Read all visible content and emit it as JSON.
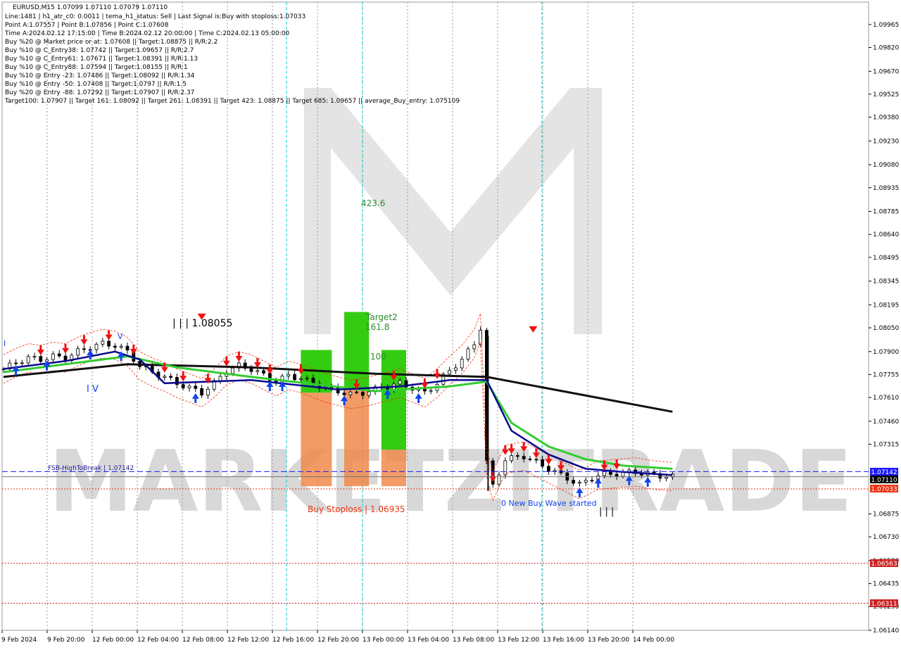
{
  "header": {
    "symbol_line": "EURUSD,M15  1.07099 1.07110 1.07079 1.07110",
    "info_lines": [
      "Line:1481 | h1_atr_c0: 0.0011 | tema_h1_status: Sell | Last Signal is:Buy with stoploss:1.07033",
      "Point A:1.07557 | Point B:1.07856 | Point C:1.07608",
      "Time A:2024.02.12 17:15:00 | Time B:2024.02.12 20:00:00 | Time C:2024.02.13 05:00:00",
      "Buy %20 @ Market price or at: 1.07608 || Target:1.08875 || R/R:2.2",
      "Buy %10 @ C_Entry38: 1.07742 || Target:1.09657 || R/R:2.7",
      "Buy %10 @ C_Entry61: 1.07671 || Target:1.08391 || R/R:1.13",
      "Buy %10 @ C_Entry88: 1.07594 || Target:1.08155 || R/R:1",
      "Buy %10 @ Entry -23: 1.07486 || Target:1.08092 || R/R:1.34",
      "Buy %10 @ Entry -50: 1.07408 || Target:1.0797 || R/R:1.5",
      "Buy %20 @ Entry -88: 1.07292 || Target:1.07907 || R/R:2.37",
      "Target100: 1.07907 || Target 161: 1.08092 || Target 261: 1.08391 || Target 423: 1.08875 || Target 685: 1.09657 || average_Buy_entry: 1.075109"
    ]
  },
  "annotations": {
    "high_label": "| | | 1.08055",
    "wave_label_iv": "I V",
    "fsb_label": "FSB-HighToBreak | 1.07142",
    "buy_stoploss": "Buy Stoploss | 1.06935",
    "new_wave": "0 New Buy Wave started",
    "target_423": "423.6",
    "target2_a": "Target2",
    "target2_b": "161.8",
    "target_100": "100",
    "wave_iii": "| | |",
    "wave_v": "V",
    "wave_i": "I"
  },
  "price_badges": {
    "fsb": "1.07142",
    "current": "1.07110",
    "stop": "1.07033",
    "level1": "1.06563",
    "level2": "1.06311"
  },
  "colors": {
    "background": "#ffffff",
    "ema_green": "#33cc33",
    "ema_navy": "#0a0a8c",
    "sma_black": "#111111",
    "red_arrow": "#ee1111",
    "blue_arrow": "#1144ee",
    "cyan_line": "#00cccc",
    "box_green": "#33cc11",
    "box_orange": "#f08a4b",
    "fsb_blue": "#1a1aff",
    "stop_red": "#ee3311",
    "level_red": "#cc2222",
    "watermark": "#d7d7d7"
  },
  "chart_data": {
    "type": "candlestick",
    "symbol": "EURUSD",
    "timeframe": "M15",
    "ylim": [
      1.0614,
      1.0996
    ],
    "y_ticks": [
      "1.09965",
      "1.09820",
      "1.09670",
      "1.09525",
      "1.09380",
      "1.09230",
      "1.09080",
      "1.08935",
      "1.08785",
      "1.08640",
      "1.08495",
      "1.08345",
      "1.08195",
      "1.08050",
      "1.07900",
      "1.07755",
      "1.07610",
      "1.07460",
      "1.07315",
      "1.06875",
      "1.06730",
      "1.06580",
      "1.06435",
      "1.06290",
      "1.06140"
    ],
    "x_ticks": [
      "9 Feb 2024",
      "9 Feb 20:00",
      "12 Feb 00:00",
      "12 Feb 04:00",
      "12 Feb 08:00",
      "12 Feb 12:00",
      "12 Feb 16:00",
      "12 Feb 20:00",
      "13 Feb 00:00",
      "13 Feb 04:00",
      "13 Feb 08:00",
      "13 Feb 12:00",
      "13 Feb 16:00",
      "13 Feb 20:00",
      "14 Feb 00:00"
    ],
    "levels": {
      "fsb_high_to_break": 1.07142,
      "current_price": 1.0711,
      "buy_stop": 1.07033,
      "red_level_1": 1.06563,
      "red_level_2": 1.06311,
      "buy_stoploss": 1.06935
    },
    "close_path": [
      [
        0,
        1.0779
      ],
      [
        2,
        1.0783
      ],
      [
        4,
        1.0786
      ],
      [
        6,
        1.0785
      ],
      [
        8,
        1.0787
      ],
      [
        10,
        1.0786
      ],
      [
        12,
        1.079
      ],
      [
        14,
        1.0793
      ],
      [
        16,
        1.0795
      ],
      [
        18,
        1.0794
      ],
      [
        20,
        1.079
      ],
      [
        22,
        1.0781
      ],
      [
        24,
        1.0777
      ],
      [
        26,
        1.0774
      ],
      [
        28,
        1.077
      ],
      [
        30,
        1.0767
      ],
      [
        32,
        1.0764
      ],
      [
        34,
        1.077
      ],
      [
        36,
        1.0778
      ],
      [
        38,
        1.0781
      ],
      [
        40,
        1.0779
      ],
      [
        42,
        1.0775
      ],
      [
        44,
        1.0771
      ],
      [
        46,
        1.0775
      ],
      [
        48,
        1.0773
      ],
      [
        50,
        1.077
      ],
      [
        52,
        1.0767
      ],
      [
        54,
        1.0765
      ],
      [
        56,
        1.0763
      ],
      [
        58,
        1.0764
      ],
      [
        60,
        1.0766
      ],
      [
        62,
        1.0768
      ],
      [
        64,
        1.077
      ],
      [
        66,
        1.0767
      ],
      [
        68,
        1.0764
      ],
      [
        70,
        1.077
      ],
      [
        72,
        1.0778
      ],
      [
        74,
        1.0785
      ],
      [
        76,
        1.0795
      ],
      [
        77,
        1.0805
      ],
      [
        78,
        1.072
      ],
      [
        79,
        1.0705
      ],
      [
        81,
        1.0722
      ],
      [
        84,
        1.0724
      ],
      [
        87,
        1.0718
      ],
      [
        90,
        1.0712
      ],
      [
        93,
        1.0706
      ],
      [
        96,
        1.0712
      ],
      [
        99,
        1.0713
      ],
      [
        102,
        1.0714
      ],
      [
        105,
        1.0712
      ],
      [
        108,
        1.0711
      ]
    ],
    "ema_green": [
      [
        0,
        1.0777
      ],
      [
        10,
        1.0782
      ],
      [
        20,
        1.0787
      ],
      [
        28,
        1.078
      ],
      [
        40,
        1.0774
      ],
      [
        60,
        1.0765
      ],
      [
        72,
        1.0768
      ],
      [
        78,
        1.0771
      ],
      [
        82,
        1.0745
      ],
      [
        88,
        1.073
      ],
      [
        94,
        1.0722
      ],
      [
        100,
        1.0718
      ],
      [
        108,
        1.0716
      ]
    ],
    "ema_navy": [
      [
        0,
        1.0779
      ],
      [
        10,
        1.0784
      ],
      [
        18,
        1.079
      ],
      [
        22,
        1.0785
      ],
      [
        26,
        1.077
      ],
      [
        40,
        1.0772
      ],
      [
        54,
        1.0766
      ],
      [
        64,
        1.0768
      ],
      [
        72,
        1.0772
      ],
      [
        78,
        1.0772
      ],
      [
        82,
        1.074
      ],
      [
        88,
        1.0725
      ],
      [
        94,
        1.0716
      ],
      [
        100,
        1.0714
      ],
      [
        108,
        1.0712
      ]
    ],
    "sma_black": [
      [
        0,
        1.0774
      ],
      [
        20,
        1.0782
      ],
      [
        40,
        1.078
      ],
      [
        60,
        1.0776
      ],
      [
        78,
        1.0774
      ],
      [
        108,
        1.0752
      ]
    ],
    "target_boxes": [
      {
        "x0": 48,
        "x1": 53,
        "top": 1.0791,
        "mid": 1.0764,
        "bottom": 1.0705
      },
      {
        "x0": 55,
        "x1": 59,
        "top": 1.0815,
        "mid": 1.0766,
        "bottom": 1.0705
      },
      {
        "x0": 61,
        "x1": 65,
        "top": 1.0791,
        "mid": 1.0728,
        "bottom": 1.0705
      }
    ]
  }
}
